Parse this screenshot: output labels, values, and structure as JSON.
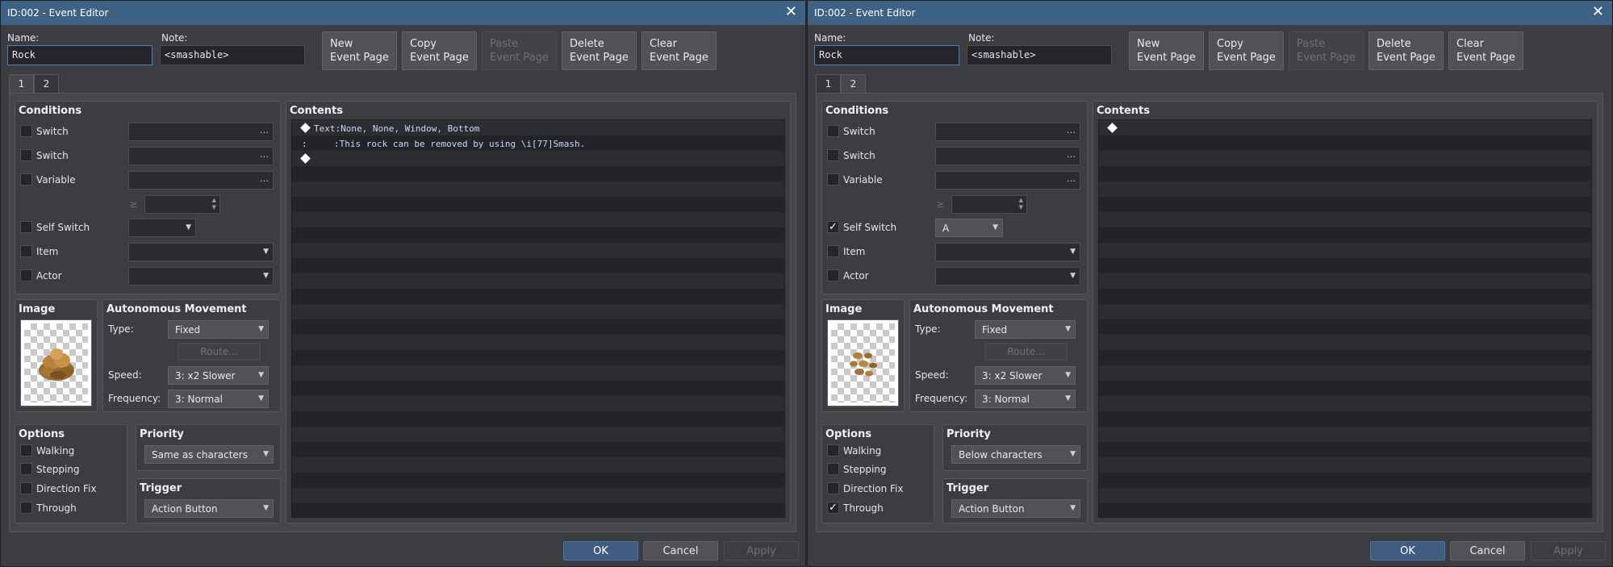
{
  "windows": [
    {
      "title": "ID:002 - Event Editor",
      "name_label": "Name:",
      "name_value": "Rock",
      "note_label": "Note:",
      "note_value": "<smashable>",
      "toolbar": [
        {
          "line1": "New",
          "line2": "Event Page",
          "enabled": true
        },
        {
          "line1": "Copy",
          "line2": "Event Page",
          "enabled": true
        },
        {
          "line1": "Paste",
          "line2": "Event Page",
          "enabled": false
        },
        {
          "line1": "Delete",
          "line2": "Event Page",
          "enabled": true
        },
        {
          "line1": "Clear",
          "line2": "Event Page",
          "enabled": true
        }
      ],
      "tabs": [
        "1",
        "2"
      ],
      "active_tab": 0,
      "conditions": {
        "title": "Conditions",
        "switch1_label": "Switch",
        "switch2_label": "Switch",
        "variable_label": "Variable",
        "ge_symbol": "≥",
        "self_switch_label": "Self Switch",
        "self_switch_checked": false,
        "self_switch_value": "",
        "item_label": "Item",
        "actor_label": "Actor"
      },
      "image_title": "Image",
      "image_kind": "rock-large",
      "autonomous": {
        "title": "Autonomous Movement",
        "type_label": "Type:",
        "type_value": "Fixed",
        "route_label": "Route...",
        "speed_label": "Speed:",
        "speed_value": "3: x2 Slower",
        "frequency_label": "Frequency:",
        "frequency_value": "3: Normal"
      },
      "options": {
        "title": "Options",
        "walking": "Walking",
        "walking_checked": false,
        "stepping": "Stepping",
        "stepping_checked": false,
        "direction_fix": "Direction Fix",
        "direction_fix_checked": false,
        "through": "Through",
        "through_checked": false
      },
      "priority": {
        "title": "Priority",
        "value": "Same as characters"
      },
      "trigger": {
        "title": "Trigger",
        "value": "Action Button"
      },
      "contents": {
        "title": "Contents",
        "lines": [
          {
            "cmd": "Text",
            "sep": ":",
            "text": "None, None, Window, Bottom"
          },
          {
            "cont": ":",
            "sep": ":",
            "text": "This rock can be removed by using \\i[77]Smash."
          }
        ]
      },
      "footer": {
        "ok": "OK",
        "cancel": "Cancel",
        "apply": "Apply"
      }
    },
    {
      "title": "ID:002 - Event Editor",
      "name_label": "Name:",
      "name_value": "Rock",
      "note_label": "Note:",
      "note_value": "<smashable>",
      "toolbar": [
        {
          "line1": "New",
          "line2": "Event Page",
          "enabled": true
        },
        {
          "line1": "Copy",
          "line2": "Event Page",
          "enabled": true
        },
        {
          "line1": "Paste",
          "line2": "Event Page",
          "enabled": false
        },
        {
          "line1": "Delete",
          "line2": "Event Page",
          "enabled": true
        },
        {
          "line1": "Clear",
          "line2": "Event Page",
          "enabled": true
        }
      ],
      "tabs": [
        "1",
        "2"
      ],
      "active_tab": 1,
      "conditions": {
        "title": "Conditions",
        "switch1_label": "Switch",
        "switch2_label": "Switch",
        "variable_label": "Variable",
        "ge_symbol": "≥",
        "self_switch_label": "Self Switch",
        "self_switch_checked": true,
        "self_switch_value": "A",
        "item_label": "Item",
        "actor_label": "Actor"
      },
      "image_title": "Image",
      "image_kind": "rock-pebbles",
      "autonomous": {
        "title": "Autonomous Movement",
        "type_label": "Type:",
        "type_value": "Fixed",
        "route_label": "Route...",
        "speed_label": "Speed:",
        "speed_value": "3: x2 Slower",
        "frequency_label": "Frequency:",
        "frequency_value": "3: Normal"
      },
      "options": {
        "title": "Options",
        "walking": "Walking",
        "walking_checked": false,
        "stepping": "Stepping",
        "stepping_checked": false,
        "direction_fix": "Direction Fix",
        "direction_fix_checked": false,
        "through": "Through",
        "through_checked": true
      },
      "priority": {
        "title": "Priority",
        "value": "Below characters"
      },
      "trigger": {
        "title": "Trigger",
        "value": "Action Button"
      },
      "contents": {
        "title": "Contents",
        "lines": []
      },
      "footer": {
        "ok": "OK",
        "cancel": "Cancel",
        "apply": "Apply"
      }
    }
  ],
  "icons": {
    "close": "close-icon",
    "dropdown": "chevron-down-icon",
    "ellipsis": "ellipsis-icon",
    "check": "check-icon",
    "command_marker": "diamond-icon"
  },
  "colors": {
    "titlebar": "#3f6284",
    "ok_button": "#3e5d80",
    "focus_border": "#4c7fb8"
  }
}
